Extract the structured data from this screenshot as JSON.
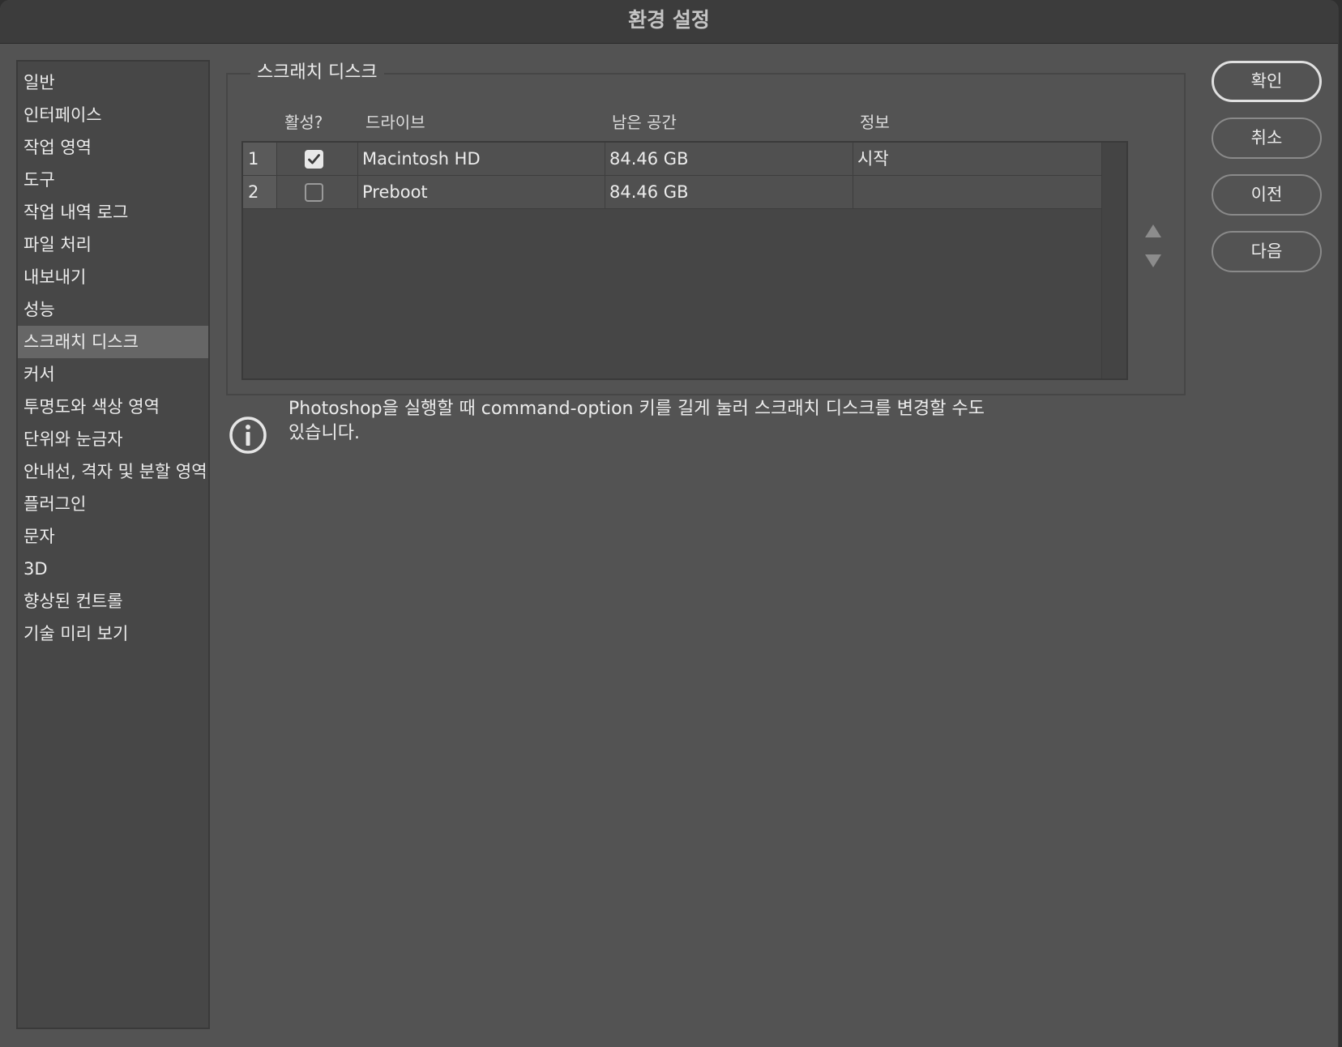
{
  "window": {
    "title": "환경 설정"
  },
  "sidebar": {
    "items": [
      {
        "label": "일반"
      },
      {
        "label": "인터페이스"
      },
      {
        "label": "작업 영역"
      },
      {
        "label": "도구"
      },
      {
        "label": "작업 내역 로그"
      },
      {
        "label": "파일 처리"
      },
      {
        "label": "내보내기"
      },
      {
        "label": "성능"
      },
      {
        "label": "스크래치 디스크",
        "selected": true
      },
      {
        "label": "커서"
      },
      {
        "label": "투명도와 색상 영역"
      },
      {
        "label": "단위와 눈금자"
      },
      {
        "label": "안내선, 격자 및 분할 영역"
      },
      {
        "label": "플러그인"
      },
      {
        "label": "문자"
      },
      {
        "label": "3D"
      },
      {
        "label": "향상된 컨트롤"
      },
      {
        "label": "기술 미리 보기"
      }
    ]
  },
  "scratch": {
    "group_title": "스크래치 디스크",
    "columns": {
      "active": "활성?",
      "drive": "드라이브",
      "free_space": "남은 공간",
      "info": "정보"
    },
    "rows": [
      {
        "index": "1",
        "active": true,
        "drive": "Macintosh HD",
        "free_space": "84.46 GB",
        "info": "시작"
      },
      {
        "index": "2",
        "active": false,
        "drive": "Preboot",
        "free_space": "84.46 GB",
        "info": ""
      }
    ],
    "move_up_icon": "triangle-up-icon",
    "move_down_icon": "triangle-down-icon"
  },
  "info": {
    "icon": "info-circle-icon",
    "text_line1": "Photoshop을 실행할 때 command-option 키를 길게 눌러 스크래치 디스크를 변경할 수도",
    "text_line2": "있습니다."
  },
  "buttons": {
    "ok": "확인",
    "cancel": "취소",
    "prev": "이전",
    "next": "다음"
  },
  "colors": {
    "window_bg": "#535353",
    "titlebar_bg": "#3c3c3c",
    "sidebar_bg": "#474747",
    "sidebar_selected": "#666666",
    "text": "#ececec"
  }
}
